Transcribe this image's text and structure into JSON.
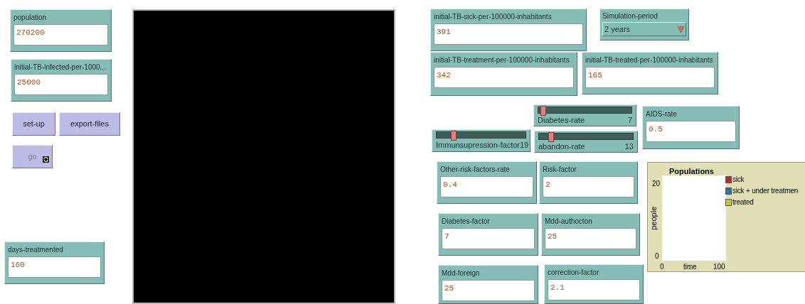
{
  "widgets": [
    {
      "kind": "input",
      "label": "population",
      "value": "270200"
    },
    {
      "kind": "input",
      "label": "initial-TB-infected-per-1000...",
      "value": "25000"
    },
    {
      "kind": "button",
      "label": "set-up",
      "disabled": false,
      "forever": false
    },
    {
      "kind": "button",
      "label": "export-files",
      "disabled": false,
      "forever": false
    },
    {
      "kind": "button",
      "label": "go",
      "disabled": true,
      "forever": true
    },
    {
      "kind": "input",
      "label": "days-treatmented",
      "value": "160"
    },
    {
      "kind": "view"
    },
    {
      "kind": "input",
      "label": "initial-TB-sick-per-100000-inhabitants",
      "value": "391"
    },
    {
      "kind": "chooser",
      "label": "Simulation-period",
      "value": "2 years"
    },
    {
      "kind": "input",
      "label": "initial-TB-treatment-per-100000-inhabitants",
      "value": "342"
    },
    {
      "kind": "input",
      "label": "initial-TB-treated-per-100000-inhabitants",
      "value": "165"
    },
    {
      "kind": "slider",
      "label": "Diabetes-rate",
      "value": "7",
      "level": 0.05
    },
    {
      "kind": "input",
      "label": "AIDS-rate",
      "value": "0.5"
    },
    {
      "kind": "slider",
      "label": "Immunsupression-factor",
      "value": "19",
      "level": 0.19
    },
    {
      "kind": "slider",
      "label": "abandon-rate",
      "value": "13",
      "level": 0.13
    },
    {
      "kind": "input",
      "label": "Other-risk-factors-rate",
      "value": "0.4"
    },
    {
      "kind": "input",
      "label": "Risk-factor",
      "value": "2"
    },
    {
      "kind": "plot",
      "title": "Populations",
      "xlabel": "time",
      "ylabel": "people",
      "x_ticks": [
        "0",
        "100"
      ],
      "y_ticks": [
        "20",
        "0"
      ],
      "legend": [
        {
          "name": "sick",
          "color": "#c0282a"
        },
        {
          "name": "sick + under treatmen",
          "color": "#2a75a8"
        },
        {
          "name": "treated",
          "color": "#c8c42a"
        }
      ]
    },
    {
      "kind": "input",
      "label": "Diabetes-factor",
      "value": "7"
    },
    {
      "kind": "input",
      "label": "Mdd-authocton",
      "value": "25"
    },
    {
      "kind": "input",
      "label": "Mdd-foreign",
      "value": "25"
    },
    {
      "kind": "input",
      "label": "correction-factor",
      "value": "2.1"
    }
  ]
}
